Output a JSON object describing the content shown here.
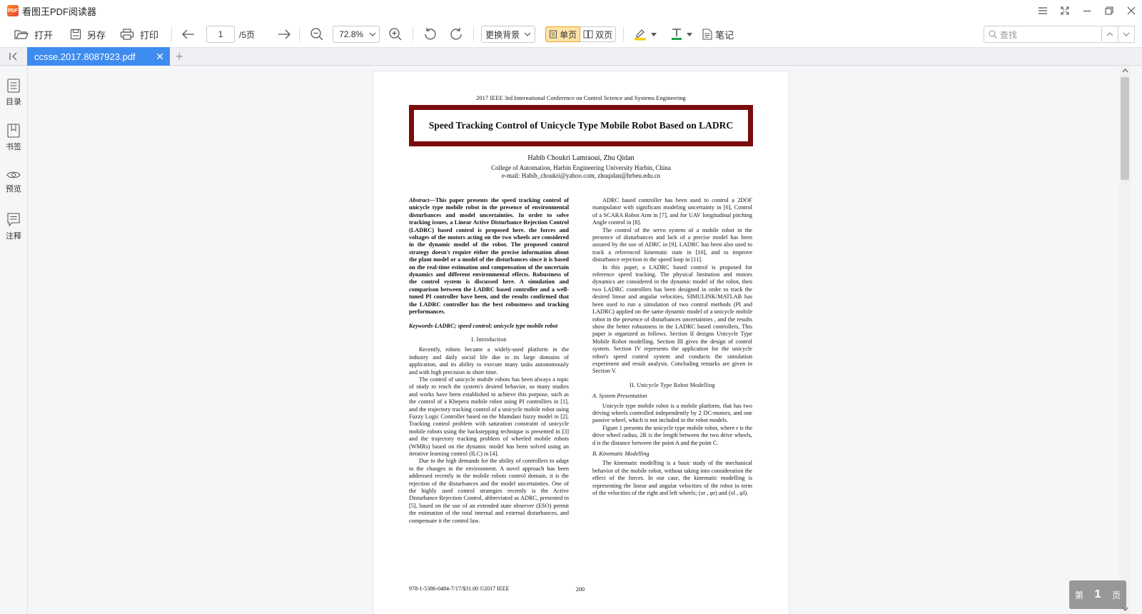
{
  "app": {
    "title": "看图王PDF阅读器",
    "logo_text": "PDF"
  },
  "toolbar": {
    "open_label": "打开",
    "saveas_label": "另存",
    "print_label": "打印",
    "page_current": "1",
    "page_total": "/5页",
    "zoom_value": "72.8%",
    "background_label": "更换背景",
    "single_page_label": "单页",
    "double_page_label": "双页",
    "notes_label": "笔记",
    "search_placeholder": "查找",
    "highlight_color": "#f5d000",
    "text_color": "#22a345"
  },
  "tabs": [
    {
      "label": "ccsse.2017.8087923.pdf",
      "active": true
    }
  ],
  "sidebar": {
    "items": [
      {
        "label": "目录",
        "icon": "toc-icon"
      },
      {
        "label": "书签",
        "icon": "bookmark-icon"
      },
      {
        "label": "预览",
        "icon": "eye-icon"
      },
      {
        "label": "注释",
        "icon": "comment-icon"
      }
    ]
  },
  "document": {
    "conference": "2017 IEEE 3rd International Conference on Control Science and Systems Engineering",
    "title": "Speed Tracking Control of Unicycle Type Mobile Robot Based on LADRC",
    "authors": "Habib Choukri Lamraoui, Zhu Qidan",
    "affiliation": "College of Automation, Harbin Engineering University Harbin, China",
    "email": "e-mail: Habib_choukri@yahoo.com, zhuqidan@hrbeu.edu.cn",
    "abstract_label": "Abstract—",
    "abstract": "This paper presents the speed tracking control of unicycle type mobile robot in the presence of environmental disturbances and model uncertainties. In order to solve tracking issues, a Linear Active Disturbance Rejection Control (LADRC) based control is proposed here. the forces and voltages of the motors acting on the two wheels are considered in the dynamic model of the robot. The proposed control strategy doesn't require either the precise information about the plant model or a model of the disturbances since it is based on the real-time estimation and compensation of the uncertain dynamics and different environmental effects. Robustness of the control system is discussed here. A simulation and comparison between the LADRC based controller and a well-tuned PI controller have been, and the results confirmed that the LADRC controller has the best robustness and tracking performances.",
    "keywords": "Keywords-LADRC; speed control; unicycle type mobile robot",
    "sec1_heading": "I.     Introduction",
    "sec1_p1": "Recently, robots became a widely-used platform in the industry and daily social life due to its large domains of application, and its ability to execute many tasks autonomously and with high precision in short time.",
    "sec1_p2": "The control of unicycle mobile robots has been always a topic of study to reach the system's desired behavior, so many studies and works have been established to achieve this purpose, such as the control of a Khepera mobile robot using PI controllers in [1], and the trajectory tracking control of a unicycle mobile robot using Fuzzy Logic Controller based on the Mamdani fuzzy model in [2]. Tracking control problem with saturation constraint of unicycle mobile robots using the backstepping technique is presented in [3] and the trajectory tracking problem of wheeled mobile robots (WMRs) based on the dynamic model has been solved using an iterative learning control (ILC) in [4].",
    "sec1_p3": "Due to the high demands for the ability of controllers to adapt to the changes in the environment. A novel approach has been addressed recently in the mobile robots control domain, it is the rejection of the disturbances and the model uncertainties. One of the highly used control strategies recently is the Active Disturbance Rejection Control, abbreviated as ADRC, presented in [5], based on the use of an extended state observer (ESO) permit the estimation of the total internal and external disturbances, and compensate it the control law.",
    "right_p1": "ADRC based controller has been used to control a 2DOF manipulator with significant modeling uncertainty in [6], Control of a SCARA Robot Arm in [7], and for UAV longitudinal pitching Angle control in [8].",
    "right_p2": "The control of the servo system of a mobile robot in the presence of disturbances and lack of a precise model has been assured by the use of ADRC in [9]. LADRC has been also used to track a referenced kinematic state in [10], and to improve disturbance rejection in the speed loop in [11].",
    "right_p3": "In this paper, a LADRC based control is proposed for reference speed tracking. The physical limitation and motors dynamics are considered in the dynamic model of the robot, then two LADRC controllers has been designed in order to track the desired linear and angular velocities, SIMULINK/MATLAB has been used to run a simulation of two control methods (PI and LADRC) applied on the same dynamic model of a unicycle mobile robot in the presence of disturbances uncertainties , and the results show the better robustness in the LADRC based controllers, This paper is organized as follows. Section II designs Unicycle Type Mobile Robot modelling. Section III gives the design of control system. Section IV represents the application for the unicycle robot's speed control system and conducts the simulation experiment and result analysis. Concluding remarks are given in Section V.",
    "sec2_heading": "II.     Unicycle Type Robot Modelling",
    "sec2a_heading": "A.  System Presentation",
    "sec2a_p1": "Unicycle type mobile robot is a mobile platform, that has two driving wheels controlled independently by 2 DC-motors, and one passive wheel, which is not included in the robot models.",
    "sec2a_p2": "Figure 1 presents the unicycle type mobile robot, where r is the drive wheel radius, 2R is the length between the two drive wheels, d is the distance between the point A and the point C.",
    "sec2b_heading": "B.  Kinematic Modelling",
    "sec2b_p1": "The kinematic modelling is a basic study of the mechanical behavior of the mobile robot, without taking into consideration the effect of the forces. In our case, the kinematic modelling is representing the linear and angular velocities of the robot in term of the velocities of the right and left wheels;  (υr , φr) and (υl , φl).",
    "footer_isbn": "978-1-5386-0484-7/17/$31.00 ©2017 IEEE",
    "footer_page": "200"
  },
  "page_indicator": {
    "prefix": "第",
    "number": "1",
    "suffix": "页"
  }
}
